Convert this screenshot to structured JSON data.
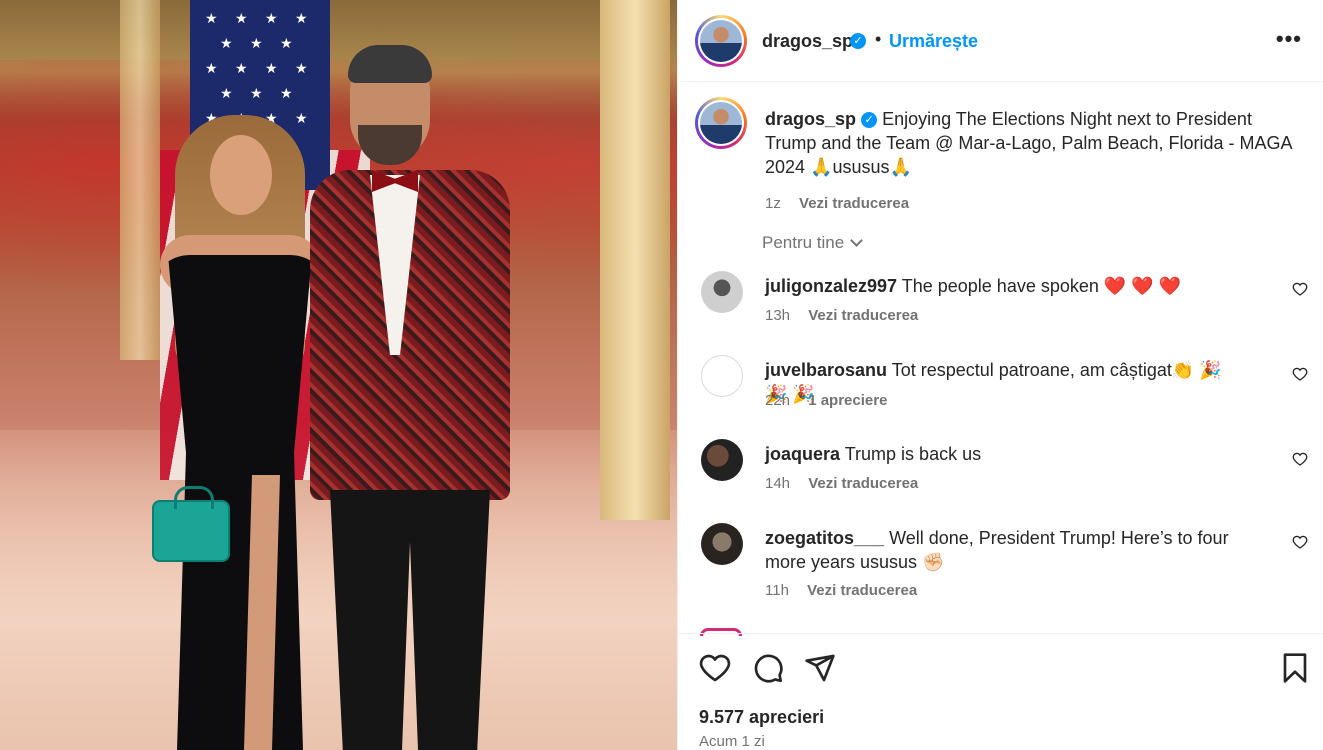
{
  "post": {
    "image_alt": "Couple posing in ballroom",
    "author": {
      "username": "dragos_sp",
      "verified": true,
      "follow_label": "Urmărește",
      "separator": "•",
      "more_label": "•••"
    },
    "caption": {
      "username": "dragos_sp",
      "text": "Enjoying The Elections Night next to President Trump and the Team @ Mar-a-Lago, Palm Beach, Florida - MAGA 2024 🙏ususus🙏",
      "age": "1z",
      "translate_label": "Vezi traducerea"
    },
    "sort_label": "Pentru tine",
    "comments": [
      {
        "username": "juligonzalez997",
        "text": "The people have spoken ❤️ ❤️ ❤️",
        "age": "13h",
        "action": "Vezi traducerea"
      },
      {
        "username": "juvelbarosanu",
        "text": "Tot respectul patroane, am câștigat👏 🎉 🎉 🎉",
        "age": "22h",
        "action": "1 apreciere"
      },
      {
        "username": "joaquera",
        "text": "Trump is back us",
        "age": "14h",
        "action": "Vezi traducerea"
      },
      {
        "username": "zoegatitos___",
        "text": "Well done, President Trump! Here’s to four more years ususus ✊🏻",
        "age": "11h",
        "action": "Vezi traducerea"
      }
    ],
    "likes": "9.577 aprecieri",
    "posted": "Acum 1 zi"
  },
  "icons": {
    "like": "heart-icon",
    "comment": "comment-icon",
    "share": "share-icon",
    "save": "bookmark-icon",
    "comment_like": "heart-icon"
  },
  "colors": {
    "accent": "#0095f6",
    "text": "#262626",
    "muted": "#737373",
    "divider": "#efefef"
  }
}
